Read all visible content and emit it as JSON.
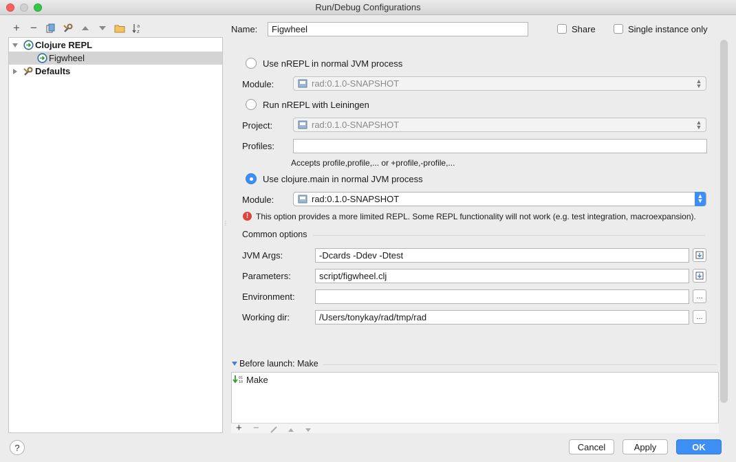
{
  "window": {
    "title": "Run/Debug Configurations"
  },
  "toolbar": {
    "add": "+",
    "remove": "−",
    "icons": [
      "copy-icon",
      "wrench-icon",
      "move-up-icon",
      "move-down-icon",
      "folder-icon",
      "sort-icon"
    ]
  },
  "tree": {
    "items": [
      {
        "label": "Clojure REPL",
        "expanded": true,
        "bold": true
      },
      {
        "label": "Figwheel",
        "selected": true
      },
      {
        "label": "Defaults",
        "expanded": false,
        "bold": true
      }
    ]
  },
  "form": {
    "name_label": "Name:",
    "name_value": "Figwheel",
    "share_label": "Share",
    "single_instance_label": "Single instance only",
    "option_nrepl_jvm": "Use nREPL in normal JVM process",
    "module_label": "Module:",
    "module_value": "rad:0.1.0-SNAPSHOT",
    "option_nrepl_lein": "Run nREPL with Leiningen",
    "project_label": "Project:",
    "project_value": "rad:0.1.0-SNAPSHOT",
    "profiles_label": "Profiles:",
    "profiles_value": "",
    "profiles_hint": "Accepts profile,profile,... or +profile,-profile,...",
    "option_clojure_main": "Use clojure.main in normal JVM process",
    "module2_label": "Module:",
    "module2_value": "rad:0.1.0-SNAPSHOT",
    "warning": "This option provides a more limited REPL. Some REPL functionality will not work (e.g. test integration, macroexpansion).",
    "common_options": "Common options",
    "jvm_args_label": "JVM Args:",
    "jvm_args_value": "-Dcards -Ddev -Dtest",
    "parameters_label": "Parameters:",
    "parameters_value": "script/figwheel.clj",
    "environment_label": "Environment:",
    "environment_value": "",
    "working_dir_label": "Working dir:",
    "working_dir_value": "/Users/tonykay/rad/tmp/rad",
    "browse": "...",
    "selected_option": "clojure_main"
  },
  "before_launch": {
    "header": "Before launch: Make",
    "items": [
      "Make"
    ]
  },
  "buttons": {
    "help": "?",
    "cancel": "Cancel",
    "apply": "Apply",
    "ok": "OK"
  },
  "colors": {
    "accent": "#3d8ef5",
    "error": "#e0433f",
    "selection": "#d4d4d4"
  }
}
